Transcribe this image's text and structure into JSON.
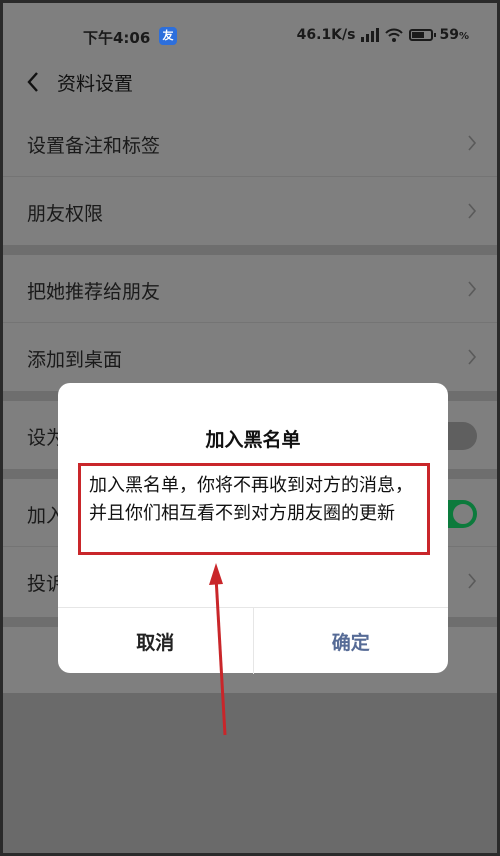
{
  "status": {
    "time": "下午4:06",
    "app_badge": "友",
    "speed": "46.1K/s",
    "battery_pct": "59",
    "pct_sign": "%",
    "battery_level": 0.59
  },
  "header": {
    "title": "资料设置"
  },
  "groups": [
    {
      "items": [
        {
          "label": "设置备注和标签"
        },
        {
          "label": "朋友权限"
        }
      ]
    },
    {
      "items": [
        {
          "label": "把她推荐给朋友"
        },
        {
          "label": "添加到桌面"
        }
      ]
    },
    {
      "items": [
        {
          "label": "设为星标朋友",
          "visible": "设为"
        },
        {
          "label": "加入黑名单",
          "visible": "加入"
        },
        {
          "label": "投诉",
          "visible": "投诉"
        }
      ]
    }
  ],
  "toggles": {
    "star_friend": false,
    "blacklist": true
  },
  "dialog": {
    "title": "加入黑名单",
    "message": "加入黑名单，你将不再收到对方的消息，并且你们相互看不到对方朋友圈的更新",
    "cancel_label": "取消",
    "confirm_label": "确定"
  },
  "colors": {
    "annotation_red": "#c9262a",
    "confirm_text": "#566b96",
    "toggle_on": "#0c7a3c"
  }
}
